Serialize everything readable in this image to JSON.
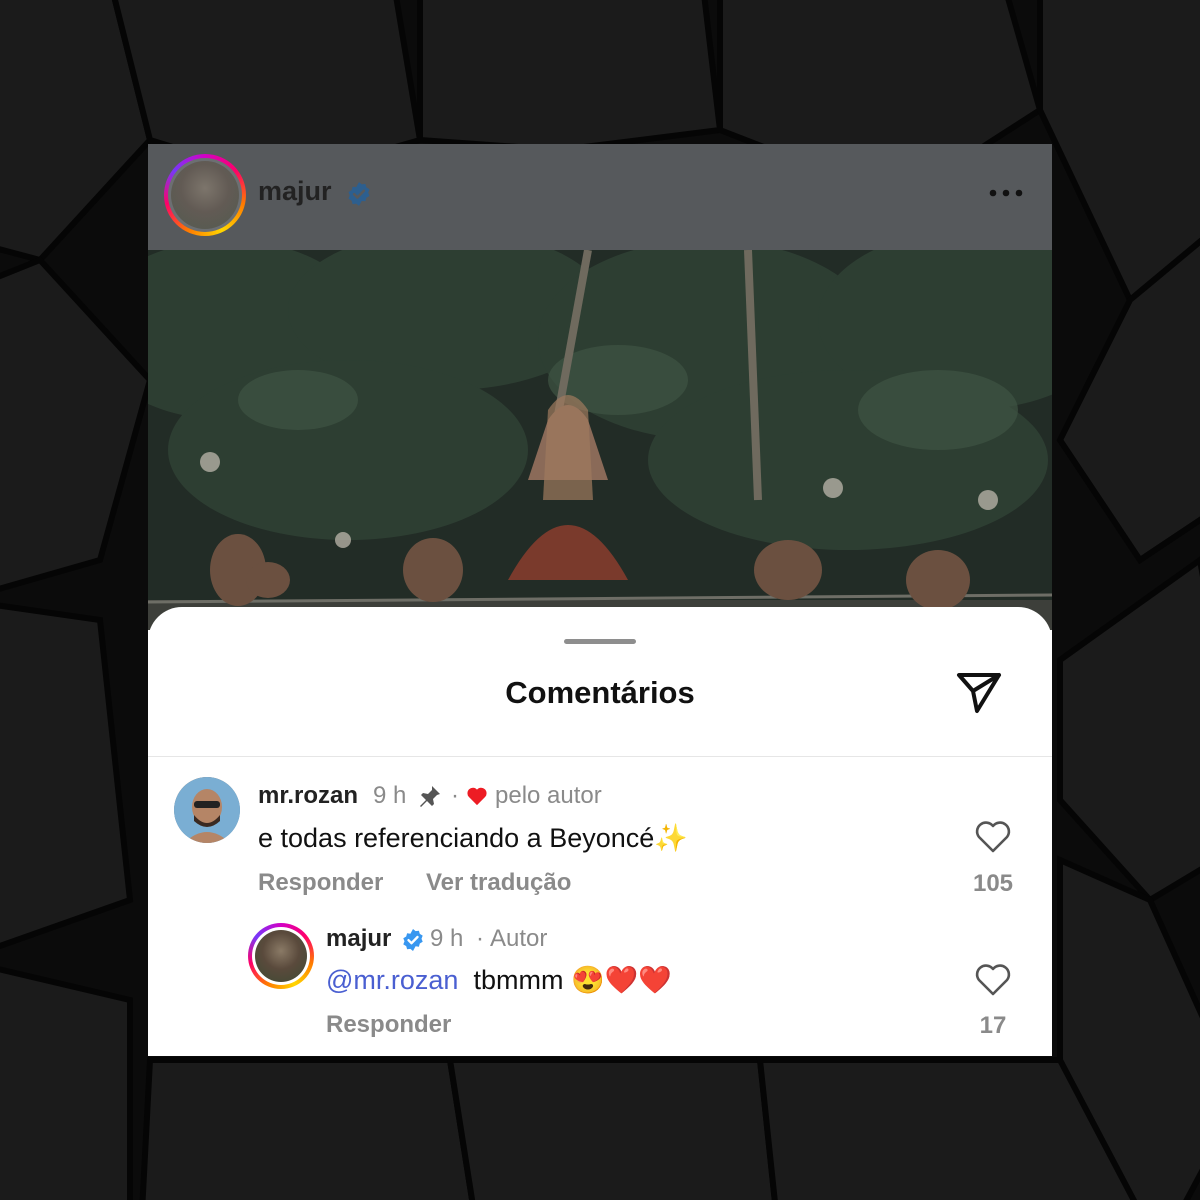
{
  "colors": {
    "page_background": "#0b0b0b",
    "header_overlay": "#56595c",
    "verified_blue": "#3897f0",
    "mention_blue": "#4a5fd1",
    "heart_red": "#ed1c24",
    "muted_text": "#8a8a8a"
  },
  "post": {
    "username": "majur",
    "verified_icon": "verified-badge-icon",
    "more_icon": "more-options-icon"
  },
  "sheet": {
    "title": "Comentários",
    "share_icon": "send-icon"
  },
  "comments": [
    {
      "username": "mr.rozan",
      "time": "9 h",
      "pinned_icon": "pin-icon",
      "separator": "·",
      "liked_by_author": "pelo autor",
      "text": "e todas referenciando a Beyoncé",
      "emoji": "✨",
      "reply_label": "Responder",
      "translate_label": "Ver tradução",
      "likes": "105",
      "replies": [
        {
          "username": "majur",
          "time": "9 h",
          "separator": "·",
          "role": "Autor",
          "mention": "@mr.rozan",
          "text": "tbmmm",
          "emoji": "😍❤️❤️",
          "reply_label": "Responder",
          "likes": "17"
        }
      ]
    }
  ]
}
